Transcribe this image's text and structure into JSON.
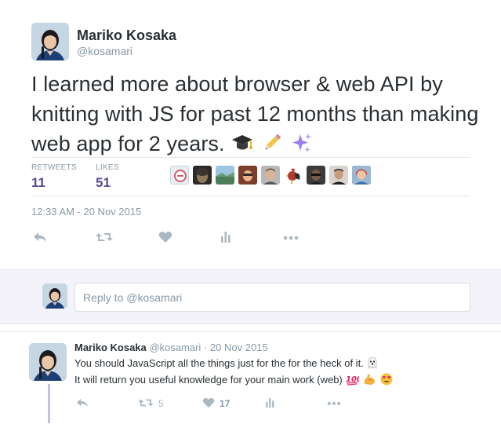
{
  "tweet": {
    "author_name": "Mariko Kosaka",
    "author_handle": "@kosamari",
    "text": "I learned more about browser & web API by knitting with JS for past 12 months than making web app for 2 years.",
    "emojis": [
      "graduation-cap",
      "pencil",
      "sparkles"
    ],
    "stats": {
      "retweets_label": "RETWEETS",
      "retweets_count": "11",
      "likes_label": "LIKES",
      "likes_count": "51"
    },
    "liker_avatar_count": 9,
    "timestamp": "12:33 AM - 20 Nov 2015",
    "action_icons": [
      "reply-icon",
      "retweet-icon",
      "like-icon",
      "analytics-icon",
      "more-icon"
    ]
  },
  "reply_box": {
    "placeholder": "Reply to @kosamari"
  },
  "reply": {
    "author_name": "Mariko Kosaka",
    "author_handle": "@kosamari",
    "separator": "·",
    "date": "20 Nov 2015",
    "line1": "You should JavaScript all the things just for the for the heck of it.",
    "line2": "It will return you useful knowledge for your main work (web)",
    "line1_emojis": [
      "ghost"
    ],
    "line2_emojis": [
      "hundred-points",
      "flexed-biceps",
      "heart-eyes"
    ],
    "retweet_count": "5",
    "like_count": "17"
  },
  "colors": {
    "accent": "#5b4b96",
    "muted": "#8899a6",
    "reply_bg": "#f5f3fa",
    "thread_line": "#c6c0dd"
  }
}
